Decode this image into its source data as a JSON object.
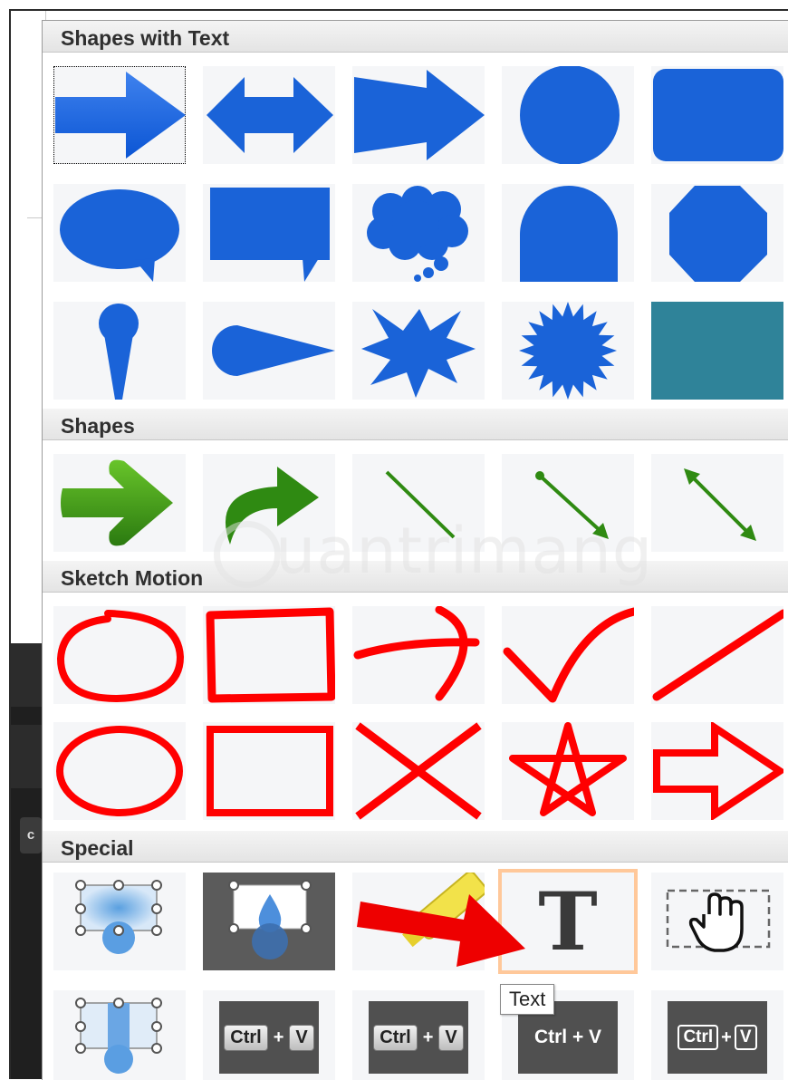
{
  "sections": {
    "shapes_with_text": "Shapes with Text",
    "shapes": "Shapes",
    "sketch_motion": "Sketch Motion",
    "special": "Special"
  },
  "watermark": "uantrimang",
  "tooltip": "Text",
  "text_tool_glyph": "T",
  "keys": {
    "ctrl": "Ctrl",
    "plus": "+",
    "v": "V",
    "ctrl_plus_v": "Ctrl + V"
  },
  "side_button": "c",
  "colors": {
    "blue": "#1a63d8",
    "green": "#2f8a12",
    "red": "#ff0000",
    "teal": "#2f8399",
    "hover": "#ffc89a"
  }
}
